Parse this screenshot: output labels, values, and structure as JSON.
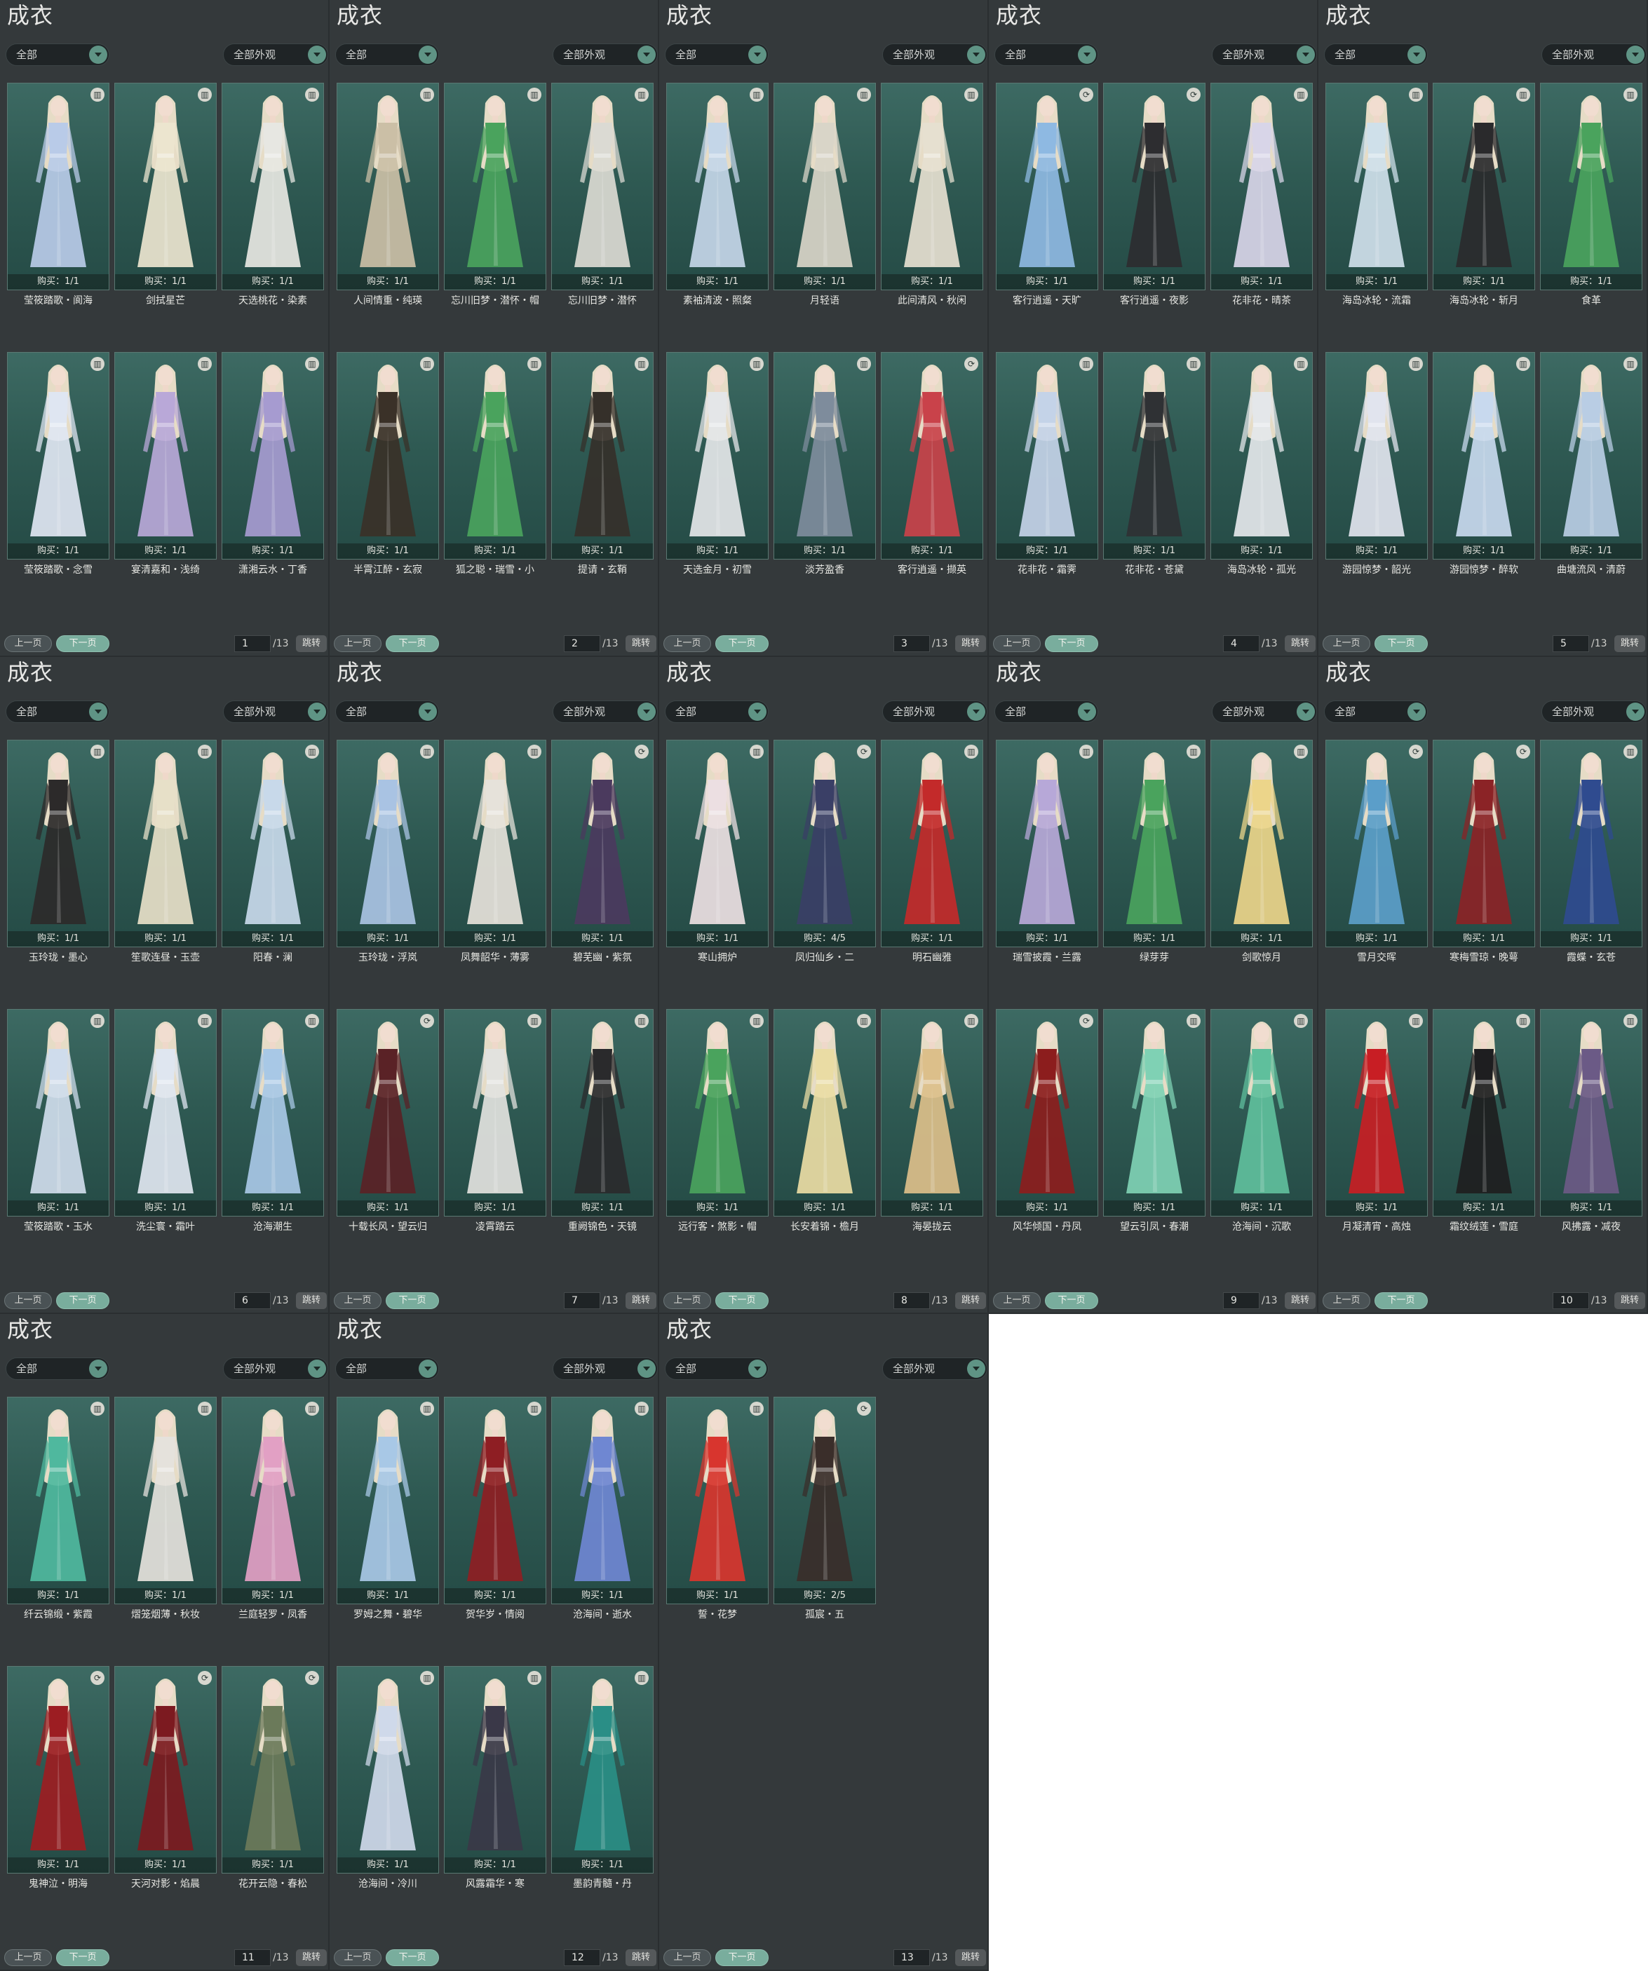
{
  "labels": {
    "title": "成衣",
    "filter_left": "全部",
    "filter_right": "全部外观",
    "prev": "上一页",
    "next": "下一页",
    "total": "/13",
    "jump": "跳转"
  },
  "colors": {
    "panel_bg": "#34393b",
    "card_bg_top": "#3d6a63",
    "card_bg_bottom": "#254b46",
    "accent": "#79ad9d",
    "white_area": "#ffffff"
  },
  "pages": [
    {
      "page": "1",
      "items": [
        {
          "name": "莹筱踏歌・阆海",
          "count": "购买：1/1",
          "icon": "bin-icon",
          "color": "#b9cbe8"
        },
        {
          "name": "剑拭星芒",
          "count": "购买：1/1",
          "icon": "bin-icon",
          "color": "#ece5cf"
        },
        {
          "name": "天选桃花・染素",
          "count": "购买：1/1",
          "icon": "bin-icon",
          "color": "#e7e7e2"
        },
        {
          "name": "莹筱踏歌・念雪",
          "count": "购买：1/1",
          "icon": "bin-icon",
          "color": "#dfe6f2"
        },
        {
          "name": "宴清嘉和・浅绮",
          "count": "购买：1/1",
          "icon": "bin-icon",
          "color": "#b9a8d8"
        },
        {
          "name": "潇湘云水・丁香",
          "count": "购买：1/1",
          "icon": "bin-icon",
          "color": "#a69bd0"
        }
      ]
    },
    {
      "page": "2",
      "items": [
        {
          "name": "人间情重・纯瑛",
          "count": "购买：1/1",
          "icon": "bin-icon",
          "color": "#cbbfa6"
        },
        {
          "name": "忘川旧梦・潜怀・帽",
          "count": "购买：1/1",
          "icon": "bin-icon",
          "color": "#4aa35d"
        },
        {
          "name": "忘川旧梦・潜怀",
          "count": "购买：1/1",
          "icon": "bin-icon",
          "color": "#dbdad3"
        },
        {
          "name": "半霄江醉・玄寂",
          "count": "购买：1/1",
          "icon": "bin-icon",
          "color": "#3a3128"
        },
        {
          "name": "狐之聪・瑞雪・小",
          "count": "购买：1/1",
          "icon": "bin-icon",
          "color": "#4aa35d"
        },
        {
          "name": "提请・玄鞘",
          "count": "购买：1/1",
          "icon": "bin-icon",
          "color": "#35302a"
        }
      ]
    },
    {
      "page": "3",
      "items": [
        {
          "name": "素袖清波・照粲",
          "count": "购买：1/1",
          "icon": "bin-icon",
          "color": "#c4d6e8"
        },
        {
          "name": "月轻语",
          "count": "购买：1/1",
          "icon": "bin-icon",
          "color": "#d9d5c8"
        },
        {
          "name": "此间清风・秋闲",
          "count": "购买：1/1",
          "icon": "bin-icon",
          "color": "#e6e0d0"
        },
        {
          "name": "天选金月・初雪",
          "count": "购买：1/1",
          "icon": "bin-icon",
          "color": "#e4e6e8"
        },
        {
          "name": "淡芳盈香",
          "count": "购买：1/1",
          "icon": "bin-icon",
          "color": "#7e8c9c"
        },
        {
          "name": "客行逍遥・撷英",
          "count": "购买：1/1",
          "icon": "refresh-icon",
          "color": "#c9424a"
        }
      ]
    },
    {
      "page": "4",
      "items": [
        {
          "name": "客行逍遥・天旷",
          "count": "购买：1/1",
          "icon": "refresh-icon",
          "color": "#8eb9e2"
        },
        {
          "name": "客行逍遥・夜影",
          "count": "购买：1/1",
          "icon": "refresh-icon",
          "color": "#2d2d30"
        },
        {
          "name": "花非花・晴茶",
          "count": "购买：1/1",
          "icon": "bin-icon",
          "color": "#d8d5e8"
        },
        {
          "name": "花非花・霜霁",
          "count": "购买：1/1",
          "icon": "bin-icon",
          "color": "#c4d3e8"
        },
        {
          "name": "花非花・苍黛",
          "count": "购买：1/1",
          "icon": "bin-icon",
          "color": "#2f3134"
        },
        {
          "name": "海岛冰轮・孤光",
          "count": "购买：1/1",
          "icon": "bin-icon",
          "color": "#e4e7ea"
        }
      ]
    },
    {
      "page": "5",
      "items": [
        {
          "name": "海岛冰轮・流霜",
          "count": "购买：1/1",
          "icon": "bin-icon",
          "color": "#cfe0ea"
        },
        {
          "name": "海岛冰轮・斩月",
          "count": "购买：1/1",
          "icon": "bin-icon",
          "color": "#2a2a2c"
        },
        {
          "name": "食革",
          "count": "购买：1/1",
          "icon": "bin-icon",
          "color": "#4aa35d"
        },
        {
          "name": "游园惊梦・韶光",
          "count": "购买：1/1",
          "icon": "bin-icon",
          "color": "#e1e4ee"
        },
        {
          "name": "游园惊梦・醉软",
          "count": "购买：1/1",
          "icon": "bin-icon",
          "color": "#c8d9ee"
        },
        {
          "name": "曲塘流风・清蔚",
          "count": "购买：1/1",
          "icon": "bin-icon",
          "color": "#b9cde4"
        }
      ]
    },
    {
      "page": "6",
      "items": [
        {
          "name": "玉玲珑・墨心",
          "count": "购买：1/1",
          "icon": "bin-icon",
          "color": "#2c2a2a"
        },
        {
          "name": "笙歌连昼・玉壶",
          "count": "购买：1/1",
          "icon": "bin-icon",
          "color": "#e7e0c8"
        },
        {
          "name": "阳春・澜",
          "count": "购买：1/1",
          "icon": "bin-icon",
          "color": "#c8d9ea"
        },
        {
          "name": "莹筱踏歌・玉水",
          "count": "购买：1/1",
          "icon": "bin-icon",
          "color": "#cfdcec"
        },
        {
          "name": "洗尘寰・霜叶",
          "count": "购买：1/1",
          "icon": "bin-icon",
          "color": "#dfe6f0"
        },
        {
          "name": "沧海潮生",
          "count": "购买：1/1",
          "icon": "bin-icon",
          "color": "#a8c8e6"
        }
      ]
    },
    {
      "page": "7",
      "items": [
        {
          "name": "玉玲珑・浮岚",
          "count": "购买：1/1",
          "icon": "bin-icon",
          "color": "#a9c3e3"
        },
        {
          "name": "凤舞韶华・薄雾",
          "count": "购买：1/1",
          "icon": "bin-icon",
          "color": "#e6e2da"
        },
        {
          "name": "碧芜幽・紫氛",
          "count": "购买：1/1",
          "icon": "refresh-icon",
          "color": "#4b3a5e"
        },
        {
          "name": "十载长风・望云归",
          "count": "购买：1/1",
          "icon": "refresh-icon",
          "color": "#5a2226"
        },
        {
          "name": "凌霄踏云",
          "count": "购买：1/1",
          "icon": "bin-icon",
          "color": "#e2e2de"
        },
        {
          "name": "重阙锦色・天镜",
          "count": "购买：1/1",
          "icon": "bin-icon",
          "color": "#2a2a2c"
        }
      ]
    },
    {
      "page": "8",
      "items": [
        {
          "name": "寒山拥炉",
          "count": "购买：1/1",
          "icon": "bin-icon",
          "color": "#ecdfe2"
        },
        {
          "name": "凤归仙乡・二",
          "count": "购买：4/5",
          "icon": "refresh-icon",
          "color": "#3a3f66"
        },
        {
          "name": "明石幽雅",
          "count": "购买：1/1",
          "icon": "bin-icon",
          "color": "#c32a2a"
        },
        {
          "name": "远行客・煞影・帽",
          "count": "购买：1/1",
          "icon": "bin-icon",
          "color": "#4aa35d"
        },
        {
          "name": "长安着锦・檐月",
          "count": "购买：1/1",
          "icon": "bin-icon",
          "color": "#eadca4"
        },
        {
          "name": "海晏拢云",
          "count": "购买：1/1",
          "icon": "bin-icon",
          "color": "#dcbf8a"
        }
      ]
    },
    {
      "page": "9",
      "items": [
        {
          "name": "瑞雪披霞・兰露",
          "count": "购买：1/1",
          "icon": "bin-icon",
          "color": "#b7a8d8"
        },
        {
          "name": "绿芽芽",
          "count": "购买：1/1",
          "icon": "bin-icon",
          "color": "#4aa35d"
        },
        {
          "name": "剑歌惊月",
          "count": "购买：1/1",
          "icon": "bin-icon",
          "color": "#ecd58a"
        },
        {
          "name": "风华倾国・丹凤",
          "count": "购买：1/1",
          "icon": "refresh-icon",
          "color": "#8c1d1d"
        },
        {
          "name": "望云引凤・春潮",
          "count": "购买：1/1",
          "icon": "bin-icon",
          "color": "#7fd1b4"
        },
        {
          "name": "沧海间・沉歌",
          "count": "购买：1/1",
          "icon": "bin-icon",
          "color": "#5fbf9c"
        }
      ]
    },
    {
      "page": "10",
      "items": [
        {
          "name": "雪月交晖",
          "count": "购买：1/1",
          "icon": "refresh-icon",
          "color": "#5b9ec9"
        },
        {
          "name": "寒梅雪琼・晚萼",
          "count": "购买：1/1",
          "icon": "refresh-icon",
          "color": "#8b2326"
        },
        {
          "name": "霞蝶・玄苍",
          "count": "购买：1/1",
          "icon": "bin-icon",
          "color": "#2f4b8f"
        },
        {
          "name": "月凝清宵・高烛",
          "count": "购买：1/1",
          "icon": "bin-icon",
          "color": "#c81e24"
        },
        {
          "name": "霜纹绒莲・雪庭",
          "count": "购买：1/1",
          "icon": "bin-icon",
          "color": "#1e1e20"
        },
        {
          "name": "风拂露・减夜",
          "count": "购买：1/1",
          "icon": "bin-icon",
          "color": "#6b5a86"
        }
      ]
    },
    {
      "page": "11",
      "items": [
        {
          "name": "纤云锦缎・紫霞",
          "count": "购买：1/1",
          "icon": "bin-icon",
          "color": "#4fb89e"
        },
        {
          "name": "熠笼烟薄・秋妆",
          "count": "购买：1/1",
          "icon": "bin-icon",
          "color": "#e5e2dc"
        },
        {
          "name": "兰庭轻罗・凤香",
          "count": "购买：1/1",
          "icon": "bin-icon",
          "color": "#e2a0c4"
        },
        {
          "name": "鬼神泣・明海",
          "count": "购买：1/1",
          "icon": "refresh-icon",
          "color": "#9c1d22"
        },
        {
          "name": "天河对影・焰晨",
          "count": "购买：1/1",
          "icon": "refresh-icon",
          "color": "#7c1a20"
        },
        {
          "name": "花开云隐・春松",
          "count": "购买：1/1",
          "icon": "refresh-icon",
          "color": "#6b7a5a"
        }
      ]
    },
    {
      "page": "12",
      "items": [
        {
          "name": "罗姆之舞・碧华",
          "count": "购买：1/1",
          "icon": "bin-icon",
          "color": "#a8c8e6"
        },
        {
          "name": "贺华岁・情阅",
          "count": "购买：1/1",
          "icon": "bin-icon",
          "color": "#8e1e23"
        },
        {
          "name": "沧海间・逝水",
          "count": "购买：1/1",
          "icon": "bin-icon",
          "color": "#6f87d2"
        },
        {
          "name": "沧海间・冷川",
          "count": "购买：1/1",
          "icon": "bin-icon",
          "color": "#cfd9ea"
        },
        {
          "name": "风露霜华・寒",
          "count": "购买：1/1",
          "icon": "bin-icon",
          "color": "#3a3848"
        },
        {
          "name": "墨韵青髓・丹",
          "count": "购买：1/1",
          "icon": "bin-icon",
          "color": "#2a8e86"
        }
      ]
    },
    {
      "page": "13",
      "items": [
        {
          "name": "誓・花梦",
          "count": "购买：1/1",
          "icon": "bin-icon",
          "color": "#d8352e"
        },
        {
          "name": "孤宸・五",
          "count": "购买：2/5",
          "icon": "refresh-icon",
          "color": "#3a2e2a"
        }
      ]
    }
  ]
}
